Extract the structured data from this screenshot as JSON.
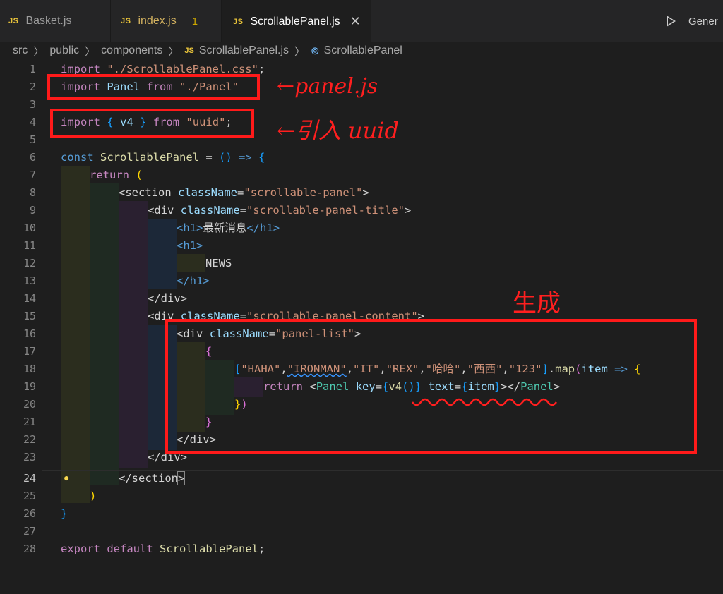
{
  "tabs": [
    {
      "label": "Basket.js",
      "icon": "JS"
    },
    {
      "label": "index.js",
      "icon": "JS",
      "problems": "1"
    },
    {
      "label": "ScrollablePanel.js",
      "icon": "JS",
      "close": "✕"
    }
  ],
  "run": {
    "label": "Gener"
  },
  "breadcrumb": {
    "parts": [
      "src",
      "public",
      "components"
    ],
    "file": "ScrollablePanel.js",
    "symbol": "ScrollablePanel",
    "js_icon": "JS",
    "sym_icon": "⊚"
  },
  "line_numbers": [
    "1",
    "2",
    "3",
    "4",
    "5",
    "6",
    "7",
    "8",
    "9",
    "10",
    "11",
    "12",
    "13",
    "14",
    "15",
    "16",
    "17",
    "18",
    "19",
    "20",
    "21",
    "22",
    "23",
    "24",
    "25",
    "26",
    "27",
    "28"
  ],
  "current_line": "24",
  "code": {
    "l1": {
      "a": "import",
      "b": "\"./ScrollablePanel.css\"",
      "c": ";"
    },
    "l2": {
      "a": "import",
      "b": "Panel",
      "c": "from",
      "d": "\"./Panel\""
    },
    "l4": {
      "a": "import",
      "b": "{",
      "c": "v4",
      "d": "}",
      "e": "from",
      "f": "\"uuid\"",
      "g": ";"
    },
    "l6": {
      "a": "const",
      "b": "ScrollablePanel",
      "c": "=",
      "d": "()",
      "e": "=>",
      "f": "{"
    },
    "l7": {
      "a": "return",
      "b": "("
    },
    "l8": {
      "a": "<",
      "b": "section",
      "c": "className",
      "d": "=",
      "e": "\"scrollable-panel\"",
      "f": ">"
    },
    "l9": {
      "a": "<",
      "b": "div",
      "c": "className",
      "d": "=",
      "e": "\"scrollable-panel-title\"",
      "f": ">"
    },
    "l10": {
      "a": "<",
      "b": "h1",
      "c": ">",
      "d": "最新消息",
      "e": "</",
      "f": "h1",
      "g": ">"
    },
    "l11": {
      "a": "<",
      "b": "h1",
      "c": ">"
    },
    "l12": {
      "a": "NEWS"
    },
    "l13": {
      "a": "</",
      "b": "h1",
      "c": ">"
    },
    "l14": {
      "a": "</",
      "b": "div",
      "c": ">"
    },
    "l15": {
      "a": "<",
      "b": "div",
      "c": "className",
      "d": "=",
      "e": "\"scrollable-panel-content\"",
      "f": ">"
    },
    "l16": {
      "a": "<",
      "b": "div",
      "c": "className",
      "d": "=",
      "e": "\"panel-list\"",
      "f": ">"
    },
    "l17": {
      "a": "{"
    },
    "l18": {
      "a": "[",
      "b": "\"HAHA\"",
      "c": ",",
      "d": "\"IRONMAN\"",
      "e": ",",
      "f": "\"IT\"",
      "g": ",",
      "h": "\"REX\"",
      "i": ",",
      "j": "\"哈哈\"",
      "k": ",",
      "l": "\"西西\"",
      "m": ",",
      "n": "\"123\"",
      "o": "]",
      "p": ".",
      "q": "map",
      "r": "(",
      "s": "item",
      "t": "=>",
      "u": "{"
    },
    "l19": {
      "a": "return",
      "b": "<",
      "c": "Panel",
      "d": "key",
      "e": "=",
      "f": "{",
      "g": "v4",
      "h": "()",
      "i": "}",
      "j": "text",
      "k": "=",
      "l": "{",
      "m": "item",
      "n": "}",
      "o": "></",
      "p": "Panel",
      "q": ">"
    },
    "l20": {
      "a": "}",
      "b": ")"
    },
    "l21": {
      "a": "}"
    },
    "l22": {
      "a": "</",
      "b": "div",
      "c": ">"
    },
    "l23": {
      "a": "</",
      "b": "div",
      "c": ">"
    },
    "l24": {
      "a": "</",
      "b": "section",
      "c": ">"
    },
    "l25": {
      "a": ")"
    },
    "l26": {
      "a": "}"
    },
    "l28": {
      "a": "export",
      "b": "default",
      "c": "ScrollablePanel",
      "d": ";"
    }
  },
  "annotations": {
    "note_panel": "←panel.js",
    "note_uuid": "←引入 uuid",
    "note_generate": "生成"
  },
  "colors": {
    "annotation": "#ff1a1a",
    "background": "#1e1e1e"
  },
  "icons": {
    "bulb": "lightbulb-icon",
    "play": "play-icon",
    "close": "close-icon"
  }
}
